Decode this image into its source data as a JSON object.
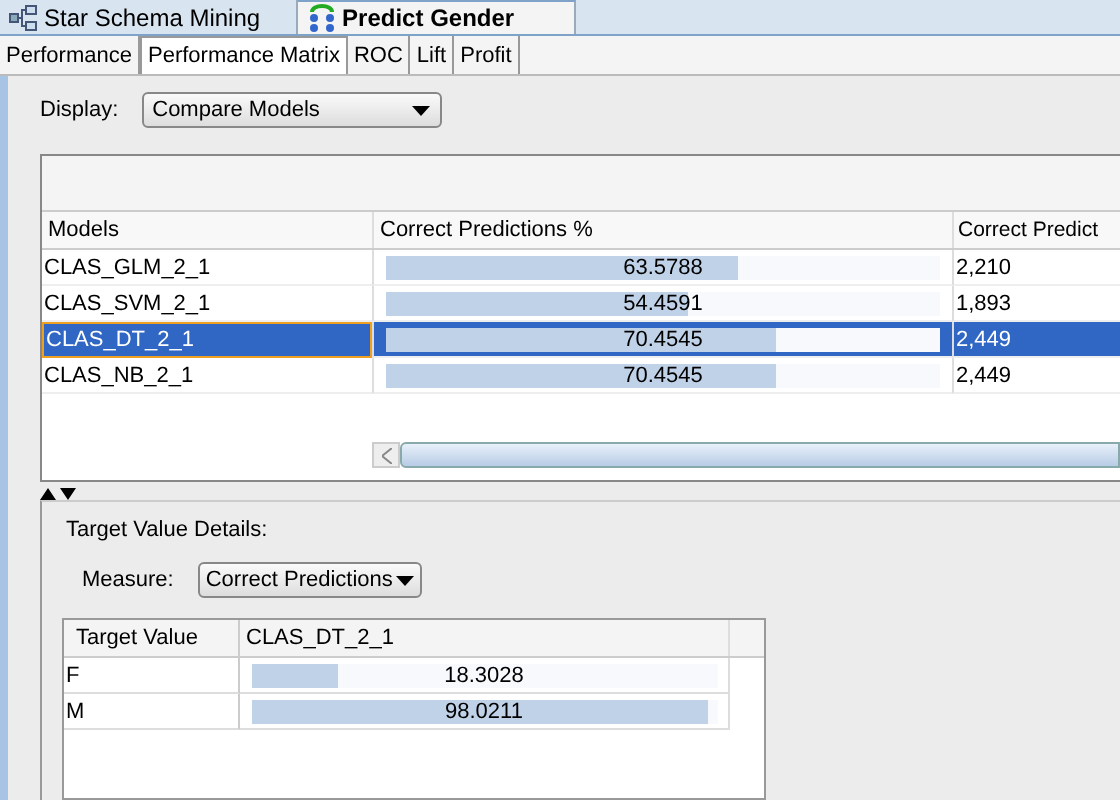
{
  "editor_tabs": [
    {
      "label": "Star Schema Mining",
      "kind": "schema",
      "selected": false
    },
    {
      "label": "Predict Gender",
      "kind": "predict",
      "selected": true
    }
  ],
  "sub_tabs": [
    {
      "label": "Performance",
      "selected": false
    },
    {
      "label": "Performance Matrix",
      "selected": true
    },
    {
      "label": "ROC",
      "selected": false
    },
    {
      "label": "Lift",
      "selected": false
    },
    {
      "label": "Profit",
      "selected": false
    }
  ],
  "display": {
    "label": "Display:",
    "value": "Compare Models"
  },
  "models_table": {
    "columns": [
      "Models",
      "Correct Predictions %",
      "Correct Predict"
    ],
    "rows": [
      {
        "model": "CLAS_GLM_2_1",
        "percent": "63.5788",
        "level": 0.635788,
        "count": "2,210",
        "selected": false
      },
      {
        "model": "CLAS_SVM_2_1",
        "percent": "54.4591",
        "level": 0.544591,
        "count": "1,893",
        "selected": false
      },
      {
        "model": "CLAS_DT_2_1",
        "percent": "70.4545",
        "level": 0.704545,
        "count": "2,449",
        "selected": true
      },
      {
        "model": "CLAS_NB_2_1",
        "percent": "70.4545",
        "level": 0.704545,
        "count": "2,449",
        "selected": false
      }
    ]
  },
  "details": {
    "title": "Target Value Details:",
    "measure_label": "Measure:",
    "measure_value": "Correct Predictions",
    "columns": [
      "Target Value",
      "CLAS_DT_2_1"
    ],
    "rows": [
      {
        "target": "F",
        "value": "18.3028",
        "level": 0.183028
      },
      {
        "target": "M",
        "value": "98.0211",
        "level": 0.980211
      }
    ]
  }
}
